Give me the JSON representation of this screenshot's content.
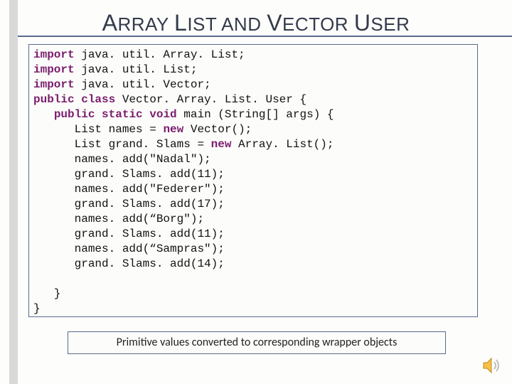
{
  "title_parts": [
    "A",
    "RRAY ",
    "L",
    "IST AND ",
    "V",
    "ECTOR ",
    "U",
    "SER"
  ],
  "code": {
    "l1": {
      "kw": "import",
      "rest": " java. util. Array. List;"
    },
    "l2": {
      "kw": "import",
      "rest": " java. util. List;"
    },
    "l3": {
      "kw": "import",
      "rest": " java. util. Vector;"
    },
    "l4": {
      "kw1": "public",
      "kw2": "class",
      "rest": " Vector. Array. List. User {"
    },
    "l5": {
      "kw1": "public",
      "kw2": "static",
      "kw3": "void",
      "rest": " main (String[] args) {"
    },
    "l6": {
      "pre": "List names = ",
      "kw": "new",
      "post": " Vector();"
    },
    "l7": {
      "pre": "List grand. Slams = ",
      "kw": "new",
      "post": " Array. List();"
    },
    "l8": "names. add(\"Nadal\");",
    "l9": "grand. Slams. add(11);",
    "l10": "names. add(\"Federer\");",
    "l11": "grand. Slams. add(17);",
    "l12": "names. add(“Borg\");",
    "l13": "grand. Slams. add(11);",
    "l14": "names. add(“Sampras\");",
    "l15": "grand. Slams. add(14);",
    "l16": "   }",
    "l17": "}"
  },
  "caption": "Primitive values converted to corresponding wrapper objects"
}
